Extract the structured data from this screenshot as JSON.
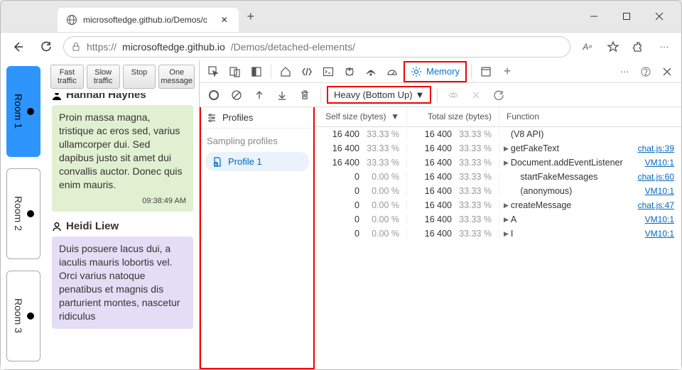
{
  "browser": {
    "tab_title": "microsoftedge.github.io/Demos/c",
    "url_prefix": "https://",
    "url_host": "microsoftedge.github.io",
    "url_path": "/Demos/detached-elements/"
  },
  "rooms": [
    {
      "label": "Room 1",
      "active": true
    },
    {
      "label": "Room 2",
      "active": false
    },
    {
      "label": "Room 3",
      "active": false
    }
  ],
  "chat_toolbar": {
    "fast": "Fast\ntraffic",
    "slow": "Slow\ntraffic",
    "stop": "Stop",
    "one": "One\nmessage"
  },
  "chat": {
    "name1": "Hannan Haynes",
    "msg1": "Proin massa magna, tristique ac eros sed, varius ullamcorper dui. Sed dapibus justo sit amet dui convallis auctor. Donec quis enim mauris.",
    "time1": "09:38:49 AM",
    "name2": "Heidi Liew",
    "msg2": "Duis posuere lacus dui, a iaculis mauris lobortis vel. Orci varius natoque penatibus et magnis dis parturient montes, nascetur ridiculus"
  },
  "devtools": {
    "memory_label": "Memory",
    "view_mode": "Heavy (Bottom Up)",
    "profiles_header": "Profiles",
    "sampling_header": "Sampling profiles",
    "profile_item": "Profile 1",
    "columns": {
      "self": "Self size (bytes)",
      "total": "Total size (bytes)",
      "func": "Function"
    },
    "rows": [
      {
        "self_v": "16 400",
        "self_p": "33.33 %",
        "total_v": "16 400",
        "total_p": "33.33 %",
        "func": "(V8 API)",
        "link": "",
        "expand": false
      },
      {
        "self_v": "16 400",
        "self_p": "33.33 %",
        "total_v": "16 400",
        "total_p": "33.33 %",
        "func": "getFakeText",
        "link": "chat.js:39",
        "expand": true
      },
      {
        "self_v": "16 400",
        "self_p": "33.33 %",
        "total_v": "16 400",
        "total_p": "33.33 %",
        "func": "Document.addEventListener",
        "link": "VM10:1",
        "expand": true
      },
      {
        "self_v": "0",
        "self_p": "0.00 %",
        "total_v": "16 400",
        "total_p": "33.33 %",
        "func": "startFakeMessages",
        "link": "chat.js:60",
        "expand": false,
        "indent": true
      },
      {
        "self_v": "0",
        "self_p": "0.00 %",
        "total_v": "16 400",
        "total_p": "33.33 %",
        "func": "(anonymous)",
        "link": "VM10:1",
        "expand": false,
        "indent": true
      },
      {
        "self_v": "0",
        "self_p": "0.00 %",
        "total_v": "16 400",
        "total_p": "33.33 %",
        "func": "createMessage",
        "link": "chat.js:47",
        "expand": true
      },
      {
        "self_v": "0",
        "self_p": "0.00 %",
        "total_v": "16 400",
        "total_p": "33.33 %",
        "func": "A",
        "link": "VM10:1",
        "expand": true
      },
      {
        "self_v": "0",
        "self_p": "0.00 %",
        "total_v": "16 400",
        "total_p": "33.33 %",
        "func": "I",
        "link": "VM10:1",
        "expand": true
      }
    ]
  }
}
